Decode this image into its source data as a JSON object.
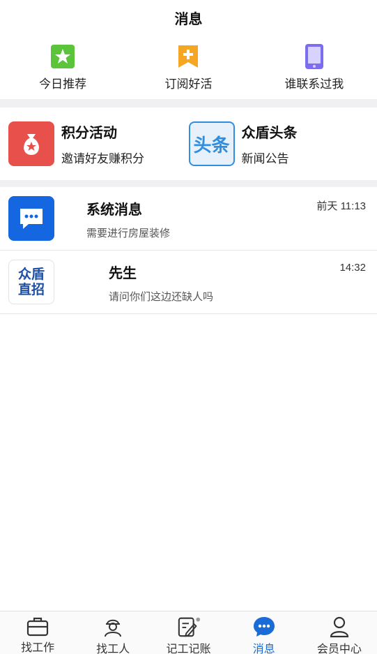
{
  "header": {
    "title": "消息"
  },
  "quick_actions": [
    {
      "label": "今日推荐",
      "icon": "star-icon",
      "color": "#5cc43a"
    },
    {
      "label": "订阅好活",
      "icon": "bookmark-plus-icon",
      "color": "#f5a623"
    },
    {
      "label": "谁联系过我",
      "icon": "phone-icon",
      "color": "#7b6cf0"
    }
  ],
  "promos": [
    {
      "title": "积分活动",
      "subtitle": "邀请好友赚积分",
      "icon": "money-bag-icon",
      "color": "#e8504b"
    },
    {
      "title": "众盾头条",
      "subtitle": "新闻公告",
      "icon": "headline-icon",
      "icon_text": "头条",
      "color": "#2f8ee0"
    }
  ],
  "messages": [
    {
      "title": "系统消息",
      "preview": "需要进行房屋装修",
      "time": "前天 11:13",
      "icon": "chat-bubble-icon",
      "color": "#1467e0"
    },
    {
      "title": "先生",
      "preview": "请问你们这边还缺人吗",
      "time": "14:32",
      "icon": "zhongdun-logo",
      "logo_line1": "众盾",
      "logo_line2": "直招"
    }
  ],
  "tabs": [
    {
      "label": "找工作",
      "icon": "briefcase-icon",
      "active": false
    },
    {
      "label": "找工人",
      "icon": "worker-icon",
      "active": false
    },
    {
      "label": "记工记账",
      "icon": "edit-note-icon",
      "active": false
    },
    {
      "label": "消息",
      "icon": "message-icon",
      "active": true
    },
    {
      "label": "会员中心",
      "icon": "user-icon",
      "active": false
    }
  ],
  "colors": {
    "accent": "#1a6bd6",
    "divider": "#f0f0f2"
  }
}
